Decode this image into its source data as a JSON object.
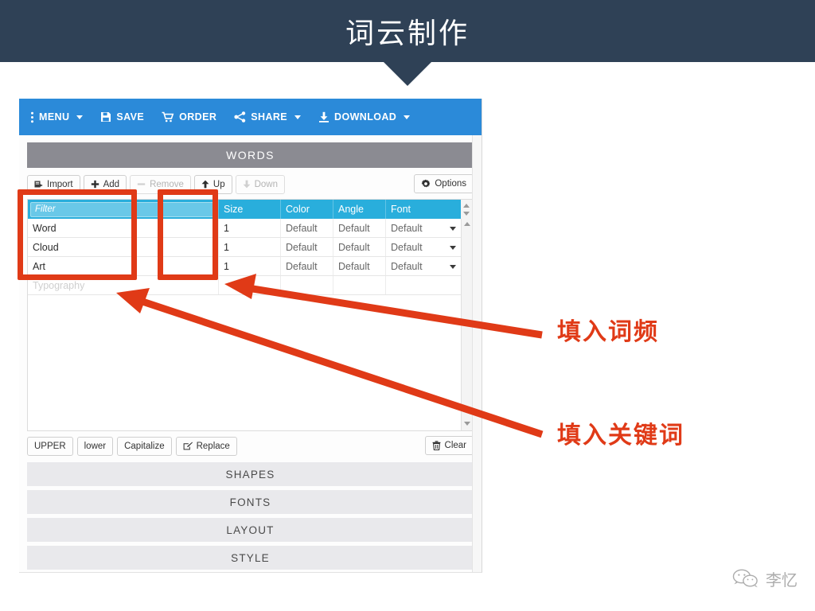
{
  "banner": {
    "title": "词云制作",
    "bg_color": "#2f4156",
    "text_color": "#ffffff"
  },
  "app": {
    "accent_blue": "#2b8ad9",
    "header_gray": "#8b8b92",
    "table_header_cyan": "#29aedc",
    "toolbar": [
      {
        "label": "MENU",
        "icon": "kebab-menu-icon",
        "caret": true
      },
      {
        "label": "SAVE",
        "icon": "floppy-disk-icon",
        "caret": false
      },
      {
        "label": "ORDER",
        "icon": "shopping-cart-icon",
        "caret": false
      },
      {
        "label": "SHARE",
        "icon": "share-nodes-icon",
        "caret": true
      },
      {
        "label": "DOWNLOAD",
        "icon": "download-arrow-icon",
        "caret": true
      }
    ],
    "section_title": "WORDS",
    "word_buttons": [
      {
        "label": "Import",
        "icon": "import-icon",
        "disabled": false
      },
      {
        "label": "Add",
        "icon": "plus-icon",
        "disabled": false
      },
      {
        "label": "Remove",
        "icon": "minus-icon",
        "disabled": true
      },
      {
        "label": "Up",
        "icon": "arrow-up-icon",
        "disabled": false
      },
      {
        "label": "Down",
        "icon": "arrow-down-icon",
        "disabled": true
      }
    ],
    "options_button": {
      "label": "Options",
      "icon": "gear-icon"
    },
    "table": {
      "filter_placeholder": "Filter",
      "columns": [
        "Size",
        "Color",
        "Angle",
        "Font"
      ],
      "rows": [
        {
          "word": "Word",
          "size": "1",
          "color": "Default",
          "angle": "Default",
          "font": "Default"
        },
        {
          "word": "Cloud",
          "size": "1",
          "color": "Default",
          "angle": "Default",
          "font": "Default"
        },
        {
          "word": "Art",
          "size": "1",
          "color": "Default",
          "angle": "Default",
          "font": "Default"
        }
      ],
      "partial_row_word": "Typography"
    },
    "case_buttons": [
      {
        "label": "UPPER",
        "icon": ""
      },
      {
        "label": "lower",
        "icon": ""
      },
      {
        "label": "Capitalize",
        "icon": ""
      },
      {
        "label": "Replace",
        "icon": "edit-pencil-icon"
      }
    ],
    "clear_button": {
      "label": "Clear",
      "icon": "trash-icon"
    },
    "accordion": [
      {
        "label": "SHAPES"
      },
      {
        "label": "FONTS"
      },
      {
        "label": "LAYOUT"
      },
      {
        "label": "STYLE"
      }
    ]
  },
  "annotations": {
    "color": "#e03a17",
    "labels": [
      {
        "text": "填入词频"
      },
      {
        "text": "填入关键词"
      }
    ]
  },
  "watermark": {
    "text": "李忆",
    "icon": "wechat-icon"
  }
}
